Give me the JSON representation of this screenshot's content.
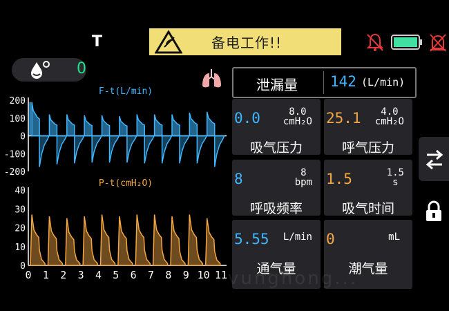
{
  "header": {
    "indicator": "T",
    "alarm_text": "备电工作!!",
    "alarm_color": "#f2de77"
  },
  "icons": {
    "mute_bell": "alarm-muted-bell-icon",
    "battery": "battery-full-icon",
    "mute_alarm": "alarm-off-icon",
    "oxygen": "oxygen-drop-icon",
    "lung": "lung-icon",
    "switch": "swap-arrows-icon",
    "lock": "lock-icon"
  },
  "oxygen": {
    "value": "0"
  },
  "leak": {
    "label": "泄漏量",
    "value": "142",
    "unit": "(L/min)"
  },
  "tiles": {
    "insp_pressure": {
      "value": "0.0",
      "set": "8.0",
      "unit": "cmH₂O",
      "name": "吸气压力",
      "color": "#3fb6ff"
    },
    "exp_pressure": {
      "value": "25.1",
      "set": "4.0",
      "unit": "cmH₂O",
      "name": "呼气压力",
      "color": "#f5a643"
    },
    "resp_rate": {
      "value": "8",
      "set": "8",
      "unit": "bpm",
      "name": "呼吸频率",
      "color": "#3fb6ff"
    },
    "insp_time": {
      "value": "1.5",
      "set": "1.5",
      "unit": "s",
      "name": "吸气时间",
      "color": "#f5a643"
    },
    "vent": {
      "value": "5.55",
      "unit": "L/min",
      "name": "通气量",
      "color": "#3fb6ff"
    },
    "tidal": {
      "value": "0",
      "unit": "mL",
      "name": "潮气量",
      "color": "#f5a643"
    }
  },
  "chart_data": [
    {
      "type": "line",
      "title": "F-t(L/min)",
      "ylim": [
        -200,
        200
      ],
      "yticks": [
        "200",
        "100",
        "0",
        "-100",
        "-200"
      ],
      "color": "#3fb6ff",
      "x": [
        0.2,
        1.2,
        2.2,
        3.2,
        4.2,
        5.2,
        6.2,
        7.2,
        8.2,
        9.2,
        10.2
      ],
      "peak_values": [
        190,
        120,
        120,
        115,
        115,
        110,
        120,
        120,
        120,
        130,
        135
      ],
      "trough_values": [
        -175,
        -160,
        -155,
        -150,
        -150,
        -150,
        -155,
        -155,
        -155,
        -155,
        -175
      ],
      "grid": false
    },
    {
      "type": "line",
      "title": "P-t(cmH₂O)",
      "ylim": [
        0,
        40
      ],
      "yticks": [
        "40",
        "30",
        "20",
        "10",
        "0"
      ],
      "xticks": [
        "0",
        "1",
        "2",
        "3",
        "4",
        "5",
        "6",
        "7",
        "8",
        "9",
        "10",
        "11"
      ],
      "color": "#f5a643",
      "x": [
        0.2,
        1.2,
        2.2,
        3.2,
        4.2,
        5.2,
        6.2,
        7.2,
        8.2,
        9.2,
        10.2
      ],
      "peak_values": [
        27,
        26,
        25,
        26,
        27,
        26,
        27,
        27,
        26,
        27,
        25
      ],
      "grid": false
    }
  ],
  "watermark": "vunghong..."
}
